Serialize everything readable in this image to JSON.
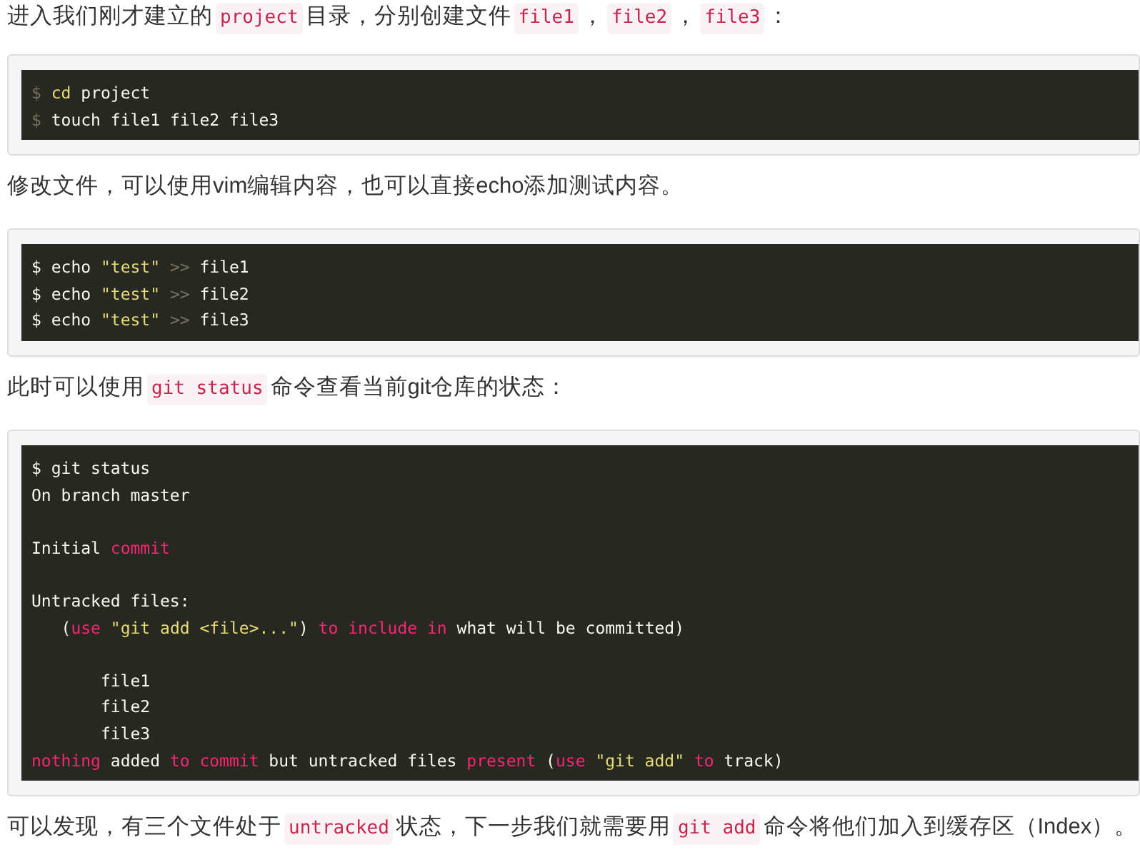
{
  "content": [
    {
      "kind": "paragraph",
      "segments": [
        {
          "kind": "text",
          "text": "进入我们刚才建立的"
        },
        {
          "kind": "code",
          "text": "project"
        },
        {
          "kind": "text",
          "text": "目录，分别创建文件"
        },
        {
          "kind": "code",
          "text": "file1"
        },
        {
          "kind": "text",
          "text": "，"
        },
        {
          "kind": "code",
          "text": "file2"
        },
        {
          "kind": "text",
          "text": "，"
        },
        {
          "kind": "code",
          "text": "file3"
        },
        {
          "kind": "text",
          "text": "："
        }
      ]
    },
    {
      "kind": "codeblock",
      "lines": [
        {
          "tokens": [
            {
              "kind": "prompt",
              "text": "$ "
            },
            {
              "kind": "builtin",
              "text": "cd"
            },
            {
              "kind": "plain",
              "text": " project"
            }
          ]
        },
        {
          "tokens": [
            {
              "kind": "prompt",
              "text": "$ "
            },
            {
              "kind": "plain",
              "text": "touch file1 file2 file3"
            }
          ]
        }
      ]
    },
    {
      "kind": "paragraph",
      "segments": [
        {
          "kind": "text",
          "text": "修改文件，可以使用vim编辑内容，也可以直接echo添加测试内容。"
        }
      ]
    },
    {
      "kind": "codeblock",
      "lines": [
        {
          "tokens": [
            {
              "kind": "plain",
              "text": "$ echo "
            },
            {
              "kind": "string",
              "text": "\"test\""
            },
            {
              "kind": "operator",
              "text": " >> "
            },
            {
              "kind": "plain",
              "text": "file1"
            }
          ]
        },
        {
          "tokens": [
            {
              "kind": "plain",
              "text": "$ echo "
            },
            {
              "kind": "string",
              "text": "\"test\""
            },
            {
              "kind": "operator",
              "text": " >> "
            },
            {
              "kind": "plain",
              "text": "file2"
            }
          ]
        },
        {
          "tokens": [
            {
              "kind": "plain",
              "text": "$ echo "
            },
            {
              "kind": "string",
              "text": "\"test\""
            },
            {
              "kind": "operator",
              "text": " >> "
            },
            {
              "kind": "plain",
              "text": "file3"
            }
          ]
        }
      ]
    },
    {
      "kind": "paragraph",
      "segments": [
        {
          "kind": "text",
          "text": "此时可以使用"
        },
        {
          "kind": "code",
          "text": "git status"
        },
        {
          "kind": "text",
          "text": "命令查看当前git仓库的状态："
        }
      ]
    },
    {
      "kind": "codeblock",
      "lines": [
        {
          "tokens": [
            {
              "kind": "plain",
              "text": "$ git status"
            }
          ]
        },
        {
          "tokens": [
            {
              "kind": "plain",
              "text": "On branch master"
            }
          ]
        },
        {
          "kind": "blank"
        },
        {
          "tokens": [
            {
              "kind": "plain",
              "text": "Initial "
            },
            {
              "kind": "keyword",
              "text": "commit"
            }
          ]
        },
        {
          "kind": "blank"
        },
        {
          "tokens": [
            {
              "kind": "plain",
              "text": "Untracked files:"
            }
          ]
        },
        {
          "tokens": [
            {
              "kind": "plain",
              "text": "   ("
            },
            {
              "kind": "keyword",
              "text": "use"
            },
            {
              "kind": "string",
              "text": " \"git add <file>...\""
            },
            {
              "kind": "plain",
              "text": ") "
            },
            {
              "kind": "keyword",
              "text": "to include in"
            },
            {
              "kind": "plain",
              "text": " what will be committed)"
            }
          ]
        },
        {
          "kind": "blank"
        },
        {
          "tokens": [
            {
              "kind": "plain",
              "text": "       file1"
            }
          ]
        },
        {
          "tokens": [
            {
              "kind": "plain",
              "text": "       file2"
            }
          ]
        },
        {
          "tokens": [
            {
              "kind": "plain",
              "text": "       file3"
            }
          ]
        },
        {
          "tokens": [
            {
              "kind": "keyword",
              "text": "nothing"
            },
            {
              "kind": "plain",
              "text": " added "
            },
            {
              "kind": "keyword",
              "text": "to commit"
            },
            {
              "kind": "plain",
              "text": " but untracked files "
            },
            {
              "kind": "keyword",
              "text": "present"
            },
            {
              "kind": "plain",
              "text": " ("
            },
            {
              "kind": "keyword",
              "text": "use"
            },
            {
              "kind": "string",
              "text": " \"git add\""
            },
            {
              "kind": "keyword",
              "text": " to"
            },
            {
              "kind": "plain",
              "text": " track)"
            }
          ]
        }
      ]
    },
    {
      "kind": "paragraph",
      "segments": [
        {
          "kind": "text",
          "text": "可以发现，有三个文件处于"
        },
        {
          "kind": "code",
          "text": "untracked"
        },
        {
          "kind": "text",
          "text": "状态，下一步我们就需要用"
        },
        {
          "kind": "code",
          "text": "git add"
        },
        {
          "kind": "text",
          "text": "命令将他们加入到缓存区（Index）。"
        }
      ]
    }
  ]
}
